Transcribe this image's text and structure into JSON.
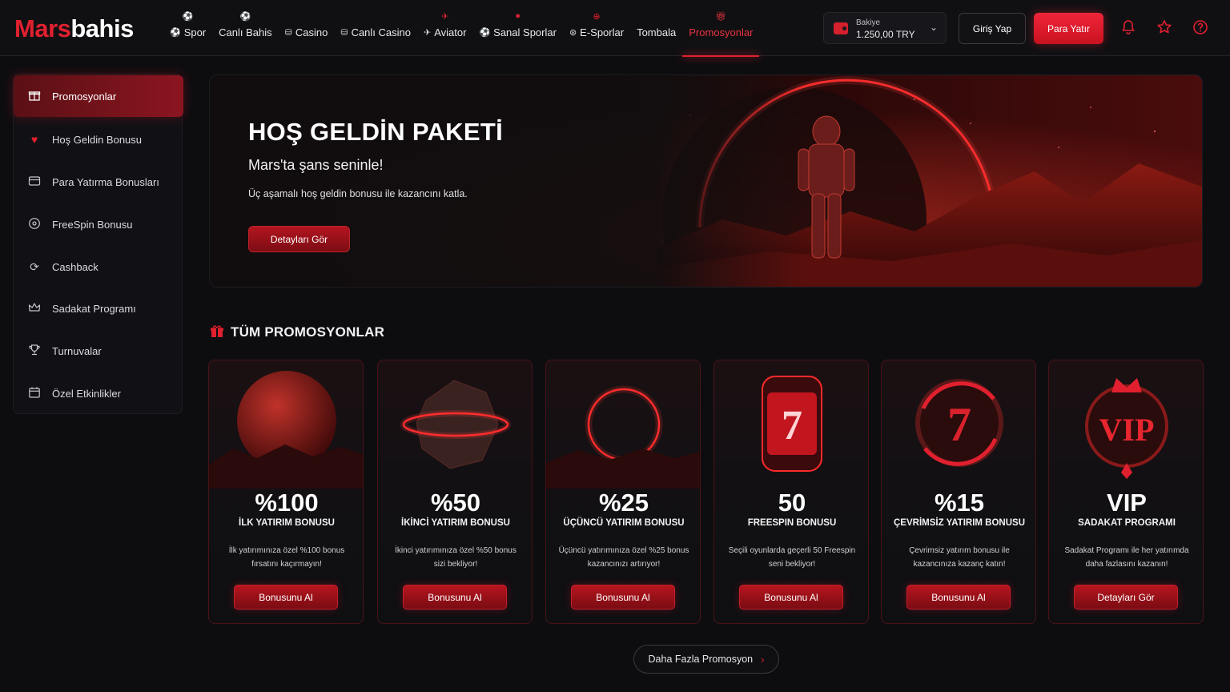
{
  "brand": {
    "part1": "Mars",
    "part2": "bahis"
  },
  "nav": [
    {
      "label": "Spor",
      "icon": "soccer-ball-icon"
    },
    {
      "label": "Canlı Bahis",
      "icon": "soccer-ball-icon"
    },
    {
      "label": "Casino",
      "icon": "casino-chip-icon"
    },
    {
      "label": "Canlı Casino",
      "icon": "casino-chip-icon"
    },
    {
      "label": "Aviator",
      "icon": "plane-icon"
    },
    {
      "label": "Sanal Sporlar",
      "icon": "soccer-ball-icon"
    },
    {
      "label": "E-Sporlar",
      "icon": "gamepad-icon"
    },
    {
      "label": "Tombala",
      "icon": ""
    },
    {
      "label": "Promosyonlar",
      "icon": "gift-icon",
      "active": true
    }
  ],
  "balance": {
    "label": "Bakiye",
    "value": "1.250,00 TRY"
  },
  "actions": {
    "login": "Giriş Yap",
    "deposit": "Para Yatır"
  },
  "sidebar": {
    "items": [
      {
        "label": "Promosyonlar",
        "icon": "gift-icon",
        "active": true
      },
      {
        "label": "Hoş Geldin Bonusu",
        "icon": "heart-icon"
      },
      {
        "label": "Para Yatırma Bonusları",
        "icon": "card-icon"
      },
      {
        "label": "FreeSpin Bonusu",
        "icon": "spin-icon"
      },
      {
        "label": "Cashback",
        "icon": "refresh-icon"
      },
      {
        "label": "Sadakat Programı",
        "icon": "crown-icon"
      },
      {
        "label": "Turnuvalar",
        "icon": "trophy-icon"
      },
      {
        "label": "Özel Etkinlikler",
        "icon": "calendar-icon"
      }
    ]
  },
  "hero": {
    "title": "HOŞ GELDİN PAKETİ",
    "subtitle": "Mars'ta şans seninle!",
    "description": "Üç aşamalı hoş geldin bonusu ile kazancını katla.",
    "button": "Detayları Gör"
  },
  "section": {
    "title": "TÜM PROMOSYONLAR"
  },
  "promos": [
    {
      "big": "%100",
      "name": "İLK YATIRIM BONUSU",
      "desc": "İlk yatırımınıza özel %100 bonus fırsatını kaçırmayın!",
      "button": "Bonusunu Al",
      "art": "planet"
    },
    {
      "big": "%50",
      "name": "İKİNCİ YATIRIM BONUSU",
      "desc": "İkinci yatırımınıza özel %50 bonus sizi bekliyor!",
      "button": "Bonusunu Al",
      "art": "asteroid"
    },
    {
      "big": "%25",
      "name": "ÜÇÜNCÜ YATIRIM BONUSU",
      "desc": "Üçüncü yatırımınıza özel %25 bonus kazancınızı artırıyor!",
      "button": "Bonusunu Al",
      "art": "portal"
    },
    {
      "big": "50",
      "name": "FREESPIN BONUSU",
      "desc": "Seçili oyunlarda geçerli 50 Freespin seni bekliyor!",
      "button": "Bonusunu Al",
      "art": "slot"
    },
    {
      "big": "%15",
      "name": "ÇEVRİMSİZ YATIRIM BONUSU",
      "desc": "Çevrimsiz yatırım bonusu ile kazancınıza kazanç katın!",
      "button": "Bonusunu Al",
      "art": "seven-coin"
    },
    {
      "big": "VIP",
      "name": "SADAKAT PROGRAMI",
      "desc": "Sadakat Programı ile her yatırımda daha fazlasını kazanın!",
      "button": "Detayları Gör",
      "art": "vip"
    }
  ],
  "more": {
    "label": "Daha Fazla Promosyon"
  },
  "colors": {
    "accent": "#e1202f",
    "background": "#0d0d10",
    "card_border": "#4a1218"
  }
}
